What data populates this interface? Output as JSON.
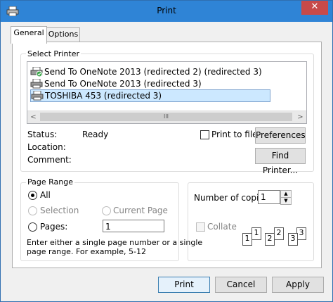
{
  "window": {
    "title": "Print",
    "close_glyph": "✕"
  },
  "tabs": [
    {
      "label": "General"
    },
    {
      "label": "Options"
    }
  ],
  "select_printer": {
    "title": "Select Printer",
    "printers": [
      {
        "name": "Send To OneNote 2013 (redirected 2) (redirected 3)",
        "icon": "printer-default-icon"
      },
      {
        "name": "Send To OneNote 2013 (redirected 3)",
        "icon": "printer-icon"
      },
      {
        "name": "TOSHIBA 453 (redirected 3)",
        "icon": "printer-icon"
      }
    ],
    "scroll_left": "<",
    "scroll_right": ">",
    "scroll_thumb": "III"
  },
  "status": {
    "label": "Status:",
    "value": "Ready"
  },
  "location": {
    "label": "Location:",
    "value": ""
  },
  "comment": {
    "label": "Comment:",
    "value": ""
  },
  "print_to_file": {
    "label": "Print to file"
  },
  "buttons": {
    "preferences": "Preferences",
    "find_printer": "Find Printer...",
    "print": "Print",
    "cancel": "Cancel",
    "apply": "Apply"
  },
  "page_range": {
    "title": "Page Range",
    "all": "All",
    "selection": "Selection",
    "current_page": "Current Page",
    "pages": "Pages:",
    "pages_value": "1",
    "hint_line1": "Enter either a single page number or a single",
    "hint_line2": "page range.  For example, 5-12"
  },
  "copies": {
    "label": "Number of copies:",
    "value": "1",
    "spin_up": "▲",
    "spin_down": "▼",
    "collate": "Collate"
  },
  "collate_pages": [
    {
      "back": "1",
      "front": "1"
    },
    {
      "back": "2",
      "front": "2"
    },
    {
      "back": "3",
      "front": "3"
    }
  ]
}
